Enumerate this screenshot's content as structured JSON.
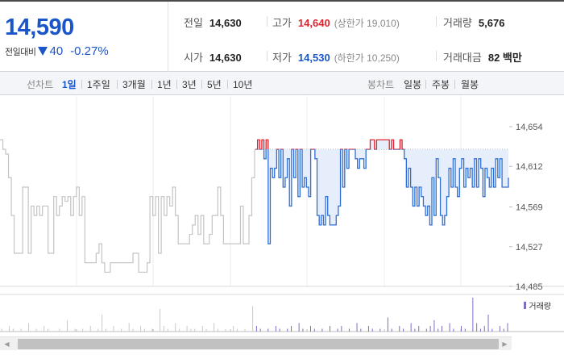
{
  "summary": {
    "current_price": "14,590",
    "change_label": "전일대비",
    "change_arrow_icon": "down-triangle-icon",
    "change_value": "40",
    "change_rate": "-0.27%",
    "prev_close": {
      "label": "전일",
      "value": "14,630"
    },
    "open": {
      "label": "시가",
      "value": "14,630"
    },
    "high": {
      "label": "고가",
      "value": "14,640",
      "sub": "(상한가 19,010)"
    },
    "low": {
      "label": "저가",
      "value": "14,530",
      "sub": "(하한가 10,250)"
    },
    "volume": {
      "label": "거래량",
      "value": "5,676"
    },
    "amount": {
      "label": "거래대금",
      "value": "82 백만"
    },
    "colors": {
      "up": "#e0212e",
      "down": "#1a56c8",
      "neutral": "#222222"
    }
  },
  "period_bar": {
    "line_label": "선차트",
    "line_periods": [
      "1일",
      "1주일",
      "3개월",
      "1년",
      "3년",
      "5년",
      "10년"
    ],
    "active_period": "1일",
    "candle_label": "봉차트",
    "candle_periods": [
      "일봉",
      "주봉",
      "월봉"
    ]
  },
  "chart_data": {
    "type": "line",
    "y_tick_labels": [
      "14,654",
      "14,612",
      "14,569",
      "14,527",
      "14,485"
    ],
    "ylim": [
      14485,
      14654
    ],
    "reference_line": 14630,
    "previous_day_series": [
      14640,
      14630,
      14625,
      14600,
      14560,
      14520,
      14520,
      14520,
      14590,
      14590,
      14520,
      14570,
      14560,
      14570,
      14560,
      14570,
      14570,
      14520,
      14520,
      14580,
      14560,
      14570,
      14580,
      14575,
      14580,
      14560,
      14580,
      14590,
      14560,
      14580,
      14510,
      14510,
      14510,
      14510,
      14520,
      14530,
      14510,
      14500,
      14500,
      14510,
      14510,
      14510,
      14510,
      14510,
      14510,
      14510,
      14510,
      14520,
      14520,
      14500,
      14500,
      14500,
      14510,
      14580,
      14560,
      14580,
      14520,
      14580,
      14560,
      14580,
      14570,
      14590,
      14560,
      14530,
      14530,
      14530,
      14530,
      14540,
      14550,
      14560,
      14540,
      14560,
      14530,
      14530,
      14540,
      14560,
      14560,
      14590,
      14560,
      14530,
      14530,
      14530,
      14530,
      14530,
      14530,
      14570,
      14530,
      14530,
      14560,
      14600,
      14630
    ],
    "today_series": [
      14630,
      14640,
      14630,
      14640,
      14620,
      14640,
      14530,
      14610,
      14600,
      14610,
      14630,
      14600,
      14630,
      14590,
      14600,
      14620,
      14570,
      14630,
      14600,
      14630,
      14580,
      14630,
      14590,
      14600,
      14590,
      14580,
      14630,
      14630,
      14620,
      14560,
      14550,
      14560,
      14550,
      14580,
      14560,
      14550,
      14550,
      14550,
      14560,
      14570,
      14630,
      14590,
      14630,
      14610,
      14630,
      14630,
      14630,
      14620,
      14610,
      14620,
      14620,
      14610,
      14630,
      14630,
      14640,
      14640,
      14630,
      14640,
      14640,
      14640,
      14640,
      14640,
      14640,
      14630,
      14640,
      14630,
      14630,
      14630,
      14640,
      14630,
      14620,
      14590,
      14610,
      14590,
      14570,
      14590,
      14570,
      14590,
      14580,
      14570,
      14560,
      14570,
      14550,
      14600,
      14560,
      14620,
      14600,
      14560,
      14550,
      14560,
      14580,
      14610,
      14590,
      14620,
      14590,
      14580,
      14610,
      14620,
      14590,
      14610,
      14600,
      14610,
      14590,
      14620,
      14590,
      14620,
      14610,
      14580,
      14610,
      14600,
      14590,
      14610,
      14590,
      14620,
      14600,
      14620,
      14590,
      14590,
      14590,
      14600
    ],
    "volume_series": [
      1,
      0,
      2,
      1,
      0,
      1,
      0,
      3,
      0,
      1,
      0,
      2,
      1,
      0,
      0,
      1,
      0,
      4,
      0,
      1,
      0,
      1,
      0,
      2,
      0,
      1,
      6,
      1,
      0,
      2,
      0,
      1,
      0,
      3,
      1,
      0,
      2,
      1,
      0,
      1,
      0,
      8,
      2,
      1,
      0,
      3,
      1,
      0,
      2,
      1,
      1,
      0,
      2,
      1,
      0,
      3,
      1,
      0,
      1,
      0,
      2,
      1,
      0,
      1,
      0,
      9,
      2,
      1,
      0,
      1,
      0,
      2,
      1,
      0,
      1,
      2,
      0,
      3,
      1,
      0,
      2,
      1,
      0,
      1,
      0,
      2,
      0,
      1,
      2,
      0,
      1,
      0,
      3,
      1,
      0,
      2,
      1,
      0,
      1,
      0,
      5,
      1,
      0,
      2,
      1,
      0,
      3,
      1,
      2,
      0,
      1,
      2,
      4,
      1,
      2,
      0,
      3,
      1,
      0,
      2,
      1,
      0,
      12,
      3,
      1,
      2,
      6,
      1,
      0,
      2,
      1,
      3
    ],
    "volume_legend": "거래량",
    "series_colors": {
      "previous": "#c4c4c4",
      "above_ref": "#e0212e",
      "below_ref": "#2f6fd6",
      "fill": "#e6eefb",
      "volume": "#7b6fc4"
    }
  },
  "scrollbar": {
    "left_icon": "scroll-left-arrow-icon",
    "right_icon": "scroll-right-arrow-icon"
  }
}
